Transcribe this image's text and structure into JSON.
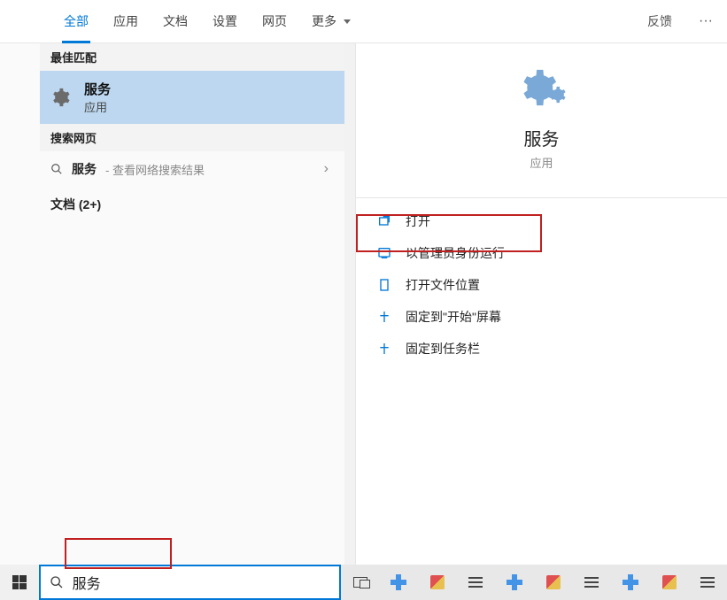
{
  "tabs": {
    "all": "全部",
    "apps": "应用",
    "docs": "文档",
    "settings": "设置",
    "web": "网页",
    "more": "更多",
    "feedback": "反馈"
  },
  "left": {
    "best_match_header": "最佳匹配",
    "best_match_title": "服务",
    "best_match_sub": "应用",
    "search_web_header": "搜索网页",
    "web_term": "服务",
    "web_suffix": " - 查看网络搜索结果",
    "docs_header": "文档 (2+)"
  },
  "preview": {
    "title": "服务",
    "sub": "应用",
    "actions": {
      "open": "打开",
      "admin": "以管理员身份运行",
      "location": "打开文件位置",
      "pin_start": "固定到\"开始\"屏幕",
      "pin_taskbar": "固定到任务栏"
    }
  },
  "search": {
    "value": "服务"
  }
}
